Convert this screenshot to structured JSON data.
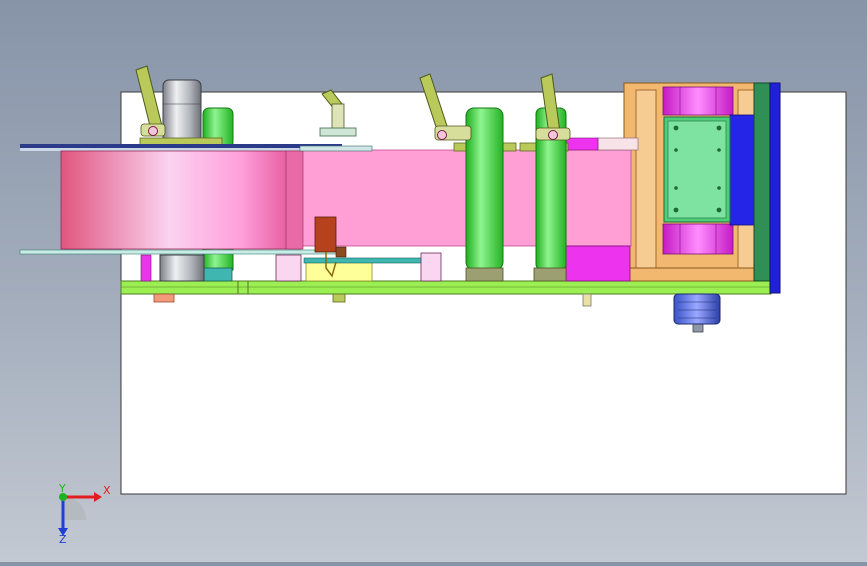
{
  "viewport": {
    "background_top": "#8794a8",
    "background_bottom": "#c3c9d2"
  },
  "sheet": {
    "color": "#ffffff"
  },
  "triad": {
    "x_label": "X",
    "y_label": "Y",
    "z_label": "Z",
    "x_color": "#e11d1d",
    "y_color": "#1fb31f",
    "z_color": "#1f3fd6"
  },
  "colors": {
    "roll_pink": "#f06fa0",
    "belt_pink": "#ff9fd6",
    "green": "#3fe23f",
    "dark_green": "#2f8f55",
    "lime": "#9cef52",
    "olive": "#b9c95a",
    "orange": "#f3b870",
    "magenta": "#ee33ee",
    "blue": "#2525e8",
    "grey": "#a9acb2",
    "teal": "#3fb7b0",
    "yellow": "#ffff9a",
    "brown": "#b5421d"
  }
}
